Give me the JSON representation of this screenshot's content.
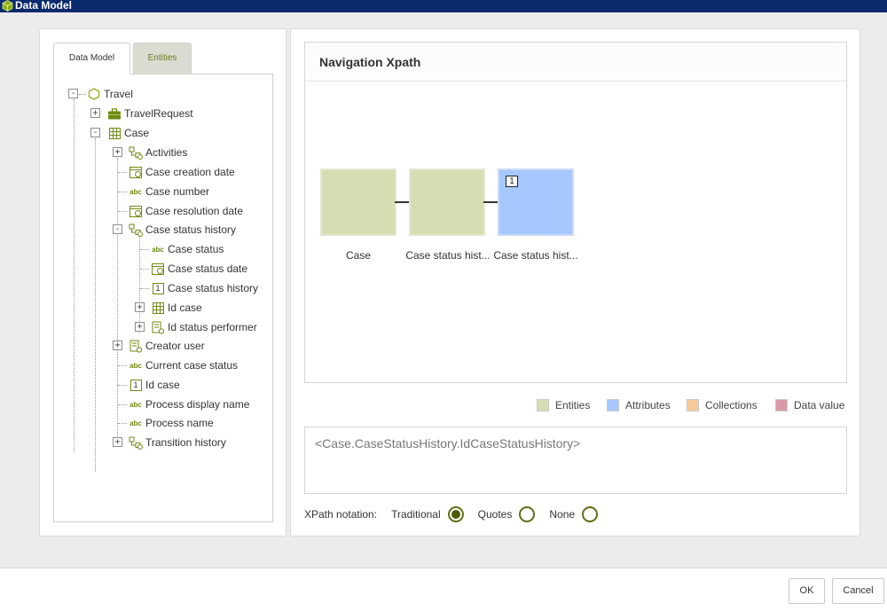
{
  "window": {
    "title": "Data Model"
  },
  "tabs": [
    {
      "label": "Data Model"
    },
    {
      "label": "Entities"
    }
  ],
  "tree": {
    "root": "Travel",
    "travel_request": "TravelRequest",
    "case": "Case",
    "activities": "Activities",
    "case_creation_date": "Case creation date",
    "case_number": "Case number",
    "case_resolution_date": "Case resolution date",
    "case_status_history": "Case status history",
    "case_status": "Case status",
    "case_status_date": "Case status date",
    "case_status_history_id": "Case status history",
    "id_case_sub": "Id case",
    "id_status_performer": "Id status performer",
    "creator_user": "Creator user",
    "current_case_status": "Current case status",
    "id_case": "Id case",
    "process_display_name": "Process display name",
    "process_name": "Process name",
    "transition_history": "Transition history",
    "expand_symbol": "+",
    "collapse_symbol": "-",
    "text_badge": "abc",
    "number_badge": "1"
  },
  "navigation": {
    "header": "Navigation Xpath",
    "nodes": [
      {
        "label": "Case",
        "kind": "entity"
      },
      {
        "label": "Case status hist...",
        "kind": "entity"
      },
      {
        "label": "Case status hist...",
        "kind": "attribute",
        "badge": "1"
      }
    ]
  },
  "legend": [
    {
      "label": "Entities",
      "color": "#d5ddb2"
    },
    {
      "label": "Attributes",
      "color": "#a6c8ff"
    },
    {
      "label": "Collections",
      "color": "#f7c99a"
    },
    {
      "label": "Data value",
      "color": "#d99aa8"
    }
  ],
  "xpath": {
    "value": "<Case.CaseStatusHistory.IdCaseStatusHistory>"
  },
  "notation": {
    "label": "XPath notation:",
    "options": [
      {
        "label": "Traditional",
        "selected": true
      },
      {
        "label": "Quotes",
        "selected": false
      },
      {
        "label": "None",
        "selected": false
      }
    ]
  },
  "buttons": {
    "ok": "OK",
    "cancel": "Cancel"
  },
  "colors": {
    "accent": "#5f6f15",
    "title_bar": "#0b2a6e",
    "entity": "#d5ddb2",
    "attribute": "#a6c8ff"
  }
}
